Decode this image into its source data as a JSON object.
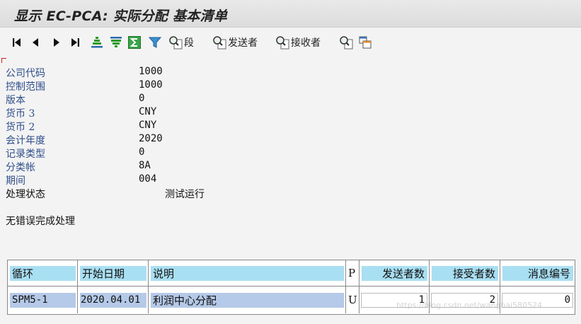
{
  "window": {
    "title": "显示 EC-PCA: 实际分配 基本清单"
  },
  "toolbar": {
    "first_label": "",
    "segment_label": "段",
    "sender_label": "发送者",
    "receiver_label": "接收者"
  },
  "header": {
    "fields": [
      {
        "label": "公司代码",
        "value": "1000"
      },
      {
        "label": "控制范围",
        "value": "1000"
      },
      {
        "label": "版本",
        "value": "0"
      },
      {
        "label": "货币 3",
        "value": "CNY"
      },
      {
        "label": "货币 2",
        "value": "CNY"
      },
      {
        "label": "会计年度",
        "value": "2020"
      },
      {
        "label": "记录类型",
        "value": "0"
      },
      {
        "label": "分类帐",
        "value": "8A"
      },
      {
        "label": "期间",
        "value": "004"
      }
    ],
    "status": {
      "label": "处理状态",
      "value": "测试运行"
    }
  },
  "message": "无错误完成处理",
  "table": {
    "columns": [
      "循环",
      "开始日期",
      "说明",
      "P",
      "发送者数",
      "接受者数",
      "消息编号"
    ],
    "rows": [
      [
        "SPM5-1",
        "2020.04.01",
        "利润中心分配",
        "U",
        "1",
        "2",
        "0"
      ]
    ]
  },
  "watermark": "https://blog.csdn.net/wangbai580524",
  "colors": {
    "header_fill": "#a9dff2",
    "selected_fill": "#b5c9e8",
    "label_blue": "#2f4e8a"
  }
}
